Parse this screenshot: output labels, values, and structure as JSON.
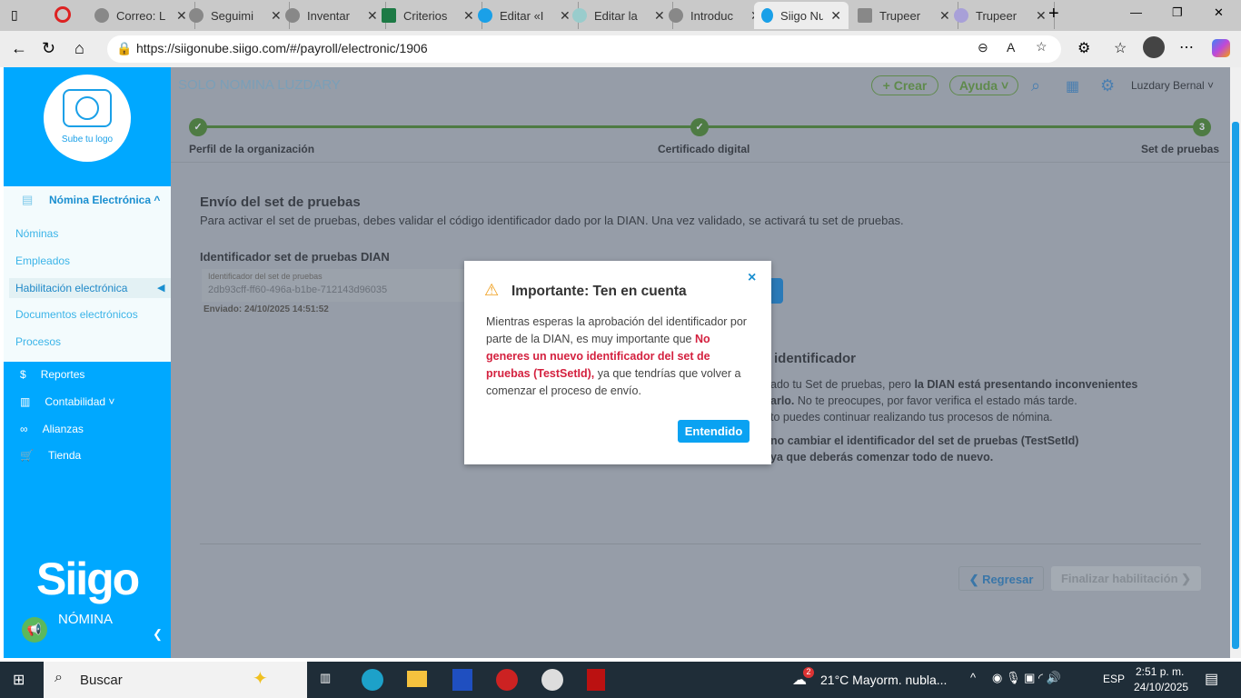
{
  "browser": {
    "tabs": [
      {
        "label": "Correo: L"
      },
      {
        "label": "Seguimi"
      },
      {
        "label": "Inventar"
      },
      {
        "label": "Criterios"
      },
      {
        "label": "Editar «I"
      },
      {
        "label": "Editar la"
      },
      {
        "label": "Introduc"
      },
      {
        "label": "Siigo Nu"
      },
      {
        "label": "Trupeer"
      },
      {
        "label": "Trupeer"
      }
    ],
    "url": "https://siigonube.siigo.com/#/payroll/electronic/1906"
  },
  "sidebar": {
    "logo_text": "Sube tu logo",
    "section": "Nómina Electrónica ^",
    "subitems": [
      "Nóminas",
      "Empleados",
      "Habilitación electrónica",
      "Documentos electrónicos",
      "Procesos"
    ],
    "items": [
      "Reportes",
      "Contabilidad ˅",
      "Alianzas",
      "Tienda"
    ],
    "brand": "Siigo",
    "brand_sub": "NÓMINA"
  },
  "header": {
    "company": "SOLO NOMINA LUZDARY",
    "create": "+ Crear",
    "help": "Ayuda ˅",
    "user": "Luzdary Bernal ˅"
  },
  "steps": [
    {
      "label": "Perfil de la organización",
      "mark": "✓"
    },
    {
      "label": "Certificado digital",
      "mark": "✓"
    },
    {
      "label": "Set de pruebas",
      "mark": "3"
    }
  ],
  "content": {
    "title": "Envío del set de pruebas",
    "desc": "Para activar el set de pruebas, debes validar el código identificador dado por la DIAN. Una vez validado, se activará tu set de pruebas.",
    "id_title": "Identificador set de pruebas DIAN",
    "id_label": "Identificador del set de pruebas",
    "id_value": "2db93cff-ff60-496a-b1be-712143d96035",
    "sent": "Enviado: 24/10/2025 14:51:52",
    "right_title": "identificador",
    "right_l1a": "ado tu Set de pruebas, pero ",
    "right_l1b": "la DIAN está presentando inconvenientes",
    "right_l2a": "arlo.",
    "right_l2b": " No te preocupes, por favor verifica el estado más tarde.",
    "right_l3": "to puedes continuar realizando tus procesos de nómina.",
    "right_l4": "no cambiar el identificador del set de pruebas (TestSetId)",
    "right_l5": "ya que deberás comenzar todo de nuevo.",
    "back": "❮ Regresar",
    "finish": "Finalizar habilitación ❯"
  },
  "modal": {
    "title": "Importante: Ten en cuenta",
    "close": "×",
    "p1": "Mientras esperas la aprobación del identificador por parte de la DIAN, es muy importante que ",
    "p2": "No generes un nuevo identificador del set de pruebas (TestSetId),",
    "p3": " ya que tendrías que volver a comenzar el proceso de envío.",
    "ok": "Entendido"
  },
  "taskbar": {
    "search": "Buscar",
    "weather": "21°C  Mayorm. nubla...",
    "lang": "ESP",
    "time": "2:51 p. m.",
    "date": "24/10/2025",
    "badge": "2"
  }
}
